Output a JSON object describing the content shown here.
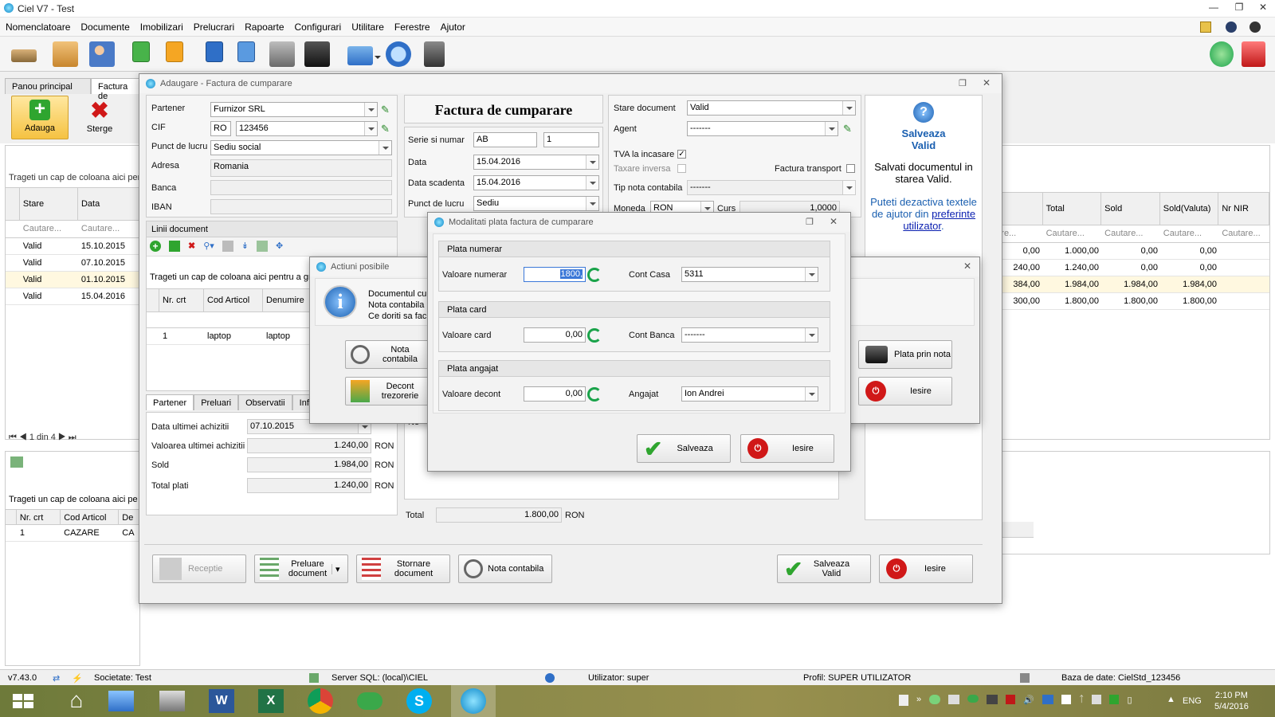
{
  "app": {
    "title": "Ciel V7 - Test"
  },
  "menu": [
    "Nomenclatoare",
    "Documente",
    "Imobilizari",
    "Prelucrari",
    "Rapoarte",
    "Configurari",
    "Utilitare",
    "Ferestre",
    "Ajutor"
  ],
  "tabs": {
    "main": "Panou principal",
    "second": "Factura de"
  },
  "ribbon": {
    "add": "Adauga",
    "delete": "Sterge"
  },
  "bg_grid": {
    "drag_hint": "Trageti un cap de coloana aici pen",
    "headers": [
      "Stare",
      "Data"
    ],
    "search": "Cautare...",
    "rows": [
      [
        "Valid",
        "15.10.2015"
      ],
      [
        "Valid",
        "07.10.2015"
      ],
      [
        "Valid",
        "01.10.2015"
      ],
      [
        "Valid",
        "15.04.2016"
      ]
    ],
    "right_headers": [
      "Total",
      "Sold",
      "Sold(Valuta)",
      "Nr NIR"
    ],
    "right_search": "Cautare...",
    "right_partial_search": "utare...",
    "right_rows": [
      [
        "0,00",
        "1.000,00",
        "0,00",
        "0,00"
      ],
      [
        "240,00",
        "1.240,00",
        "0,00",
        "0,00"
      ],
      [
        "384,00",
        "1.984,00",
        "1.984,00",
        "1.984,00"
      ],
      [
        "300,00",
        "1.800,00",
        "1.800,00",
        "1.800,00"
      ]
    ],
    "pager": "1 din 4"
  },
  "bg_lower": {
    "drag_hint": "Trageti un cap de coloana aici pe",
    "headers": [
      "Nr. crt",
      "Cod Articol",
      "De"
    ],
    "row": [
      "1",
      "CAZARE",
      "CA"
    ],
    "right_partial": "i"
  },
  "main_dialog": {
    "title": "Adaugare - Factura de cumparare",
    "heading": "Factura de cumparare",
    "partner": {
      "partener_label": "Partener",
      "partener": "Furnizor SRL",
      "cif_label": "CIF",
      "cif_prefix": "RO",
      "cif": "123456",
      "punct_label": "Punct de lucru",
      "punct": "Sediu social",
      "adresa_label": "Adresa",
      "adresa": "Romania",
      "banca_label": "Banca",
      "iban_label": "IBAN"
    },
    "serie": {
      "serie_label": "Serie si numar",
      "serie": "AB",
      "numar": "1",
      "data_label": "Data",
      "data": "15.04.2016",
      "scadenta_label": "Data scadenta",
      "scadenta": "15.04.2016",
      "punct_label": "Punct de lucru",
      "punct": "Sediu"
    },
    "stare": {
      "stare_label": "Stare document",
      "stare": "Valid",
      "agent_label": "Agent",
      "agent": "-------",
      "tva_label": "TVA la incasare",
      "taxare_label": "Taxare inversa",
      "transport_label": "Factura transport",
      "tip_label": "Tip nota contabila",
      "tip": "-------",
      "moneda_label": "Moneda",
      "moneda": "RON",
      "curs_label": "Curs",
      "curs": "1,0000"
    },
    "help": {
      "title_line1": "Salveaza",
      "title_line2": "Valid",
      "text": "Salvati documentul in starea Valid.",
      "hint_text": "Puteti dezactiva textele de ajutor din ",
      "hint_link": "preferinte utilizator",
      "hint_end": "."
    },
    "linii": {
      "title": "Linii document",
      "drag_hint": "Trageti un cap de coloana aici pentru a gr",
      "headers": [
        "Nr. crt",
        "Cod Articol",
        "Denumire"
      ],
      "row": [
        "1",
        "laptop",
        "laptop"
      ]
    },
    "lower_tabs": [
      "Partener",
      "Preluari",
      "Observatii",
      "Info"
    ],
    "partner_tab": {
      "last_date_label": "Data ultimei achizitii",
      "last_date": "07.10.2015",
      "last_value_label": "Valoarea ultimei achizitii",
      "last_value": "1.240,00",
      "sold_label": "Sold",
      "sold": "1.984,00",
      "total_label": "Total plati",
      "total": "1.240,00",
      "currency": "RON"
    },
    "partial_label": "Ne",
    "totals": {
      "label": "Total",
      "value": "1.800,00",
      "currency": "RON"
    },
    "bottom": {
      "receptie": "Receptie",
      "preluare": "Preluare document",
      "stornare": "Stornare document",
      "nota": "Nota contabila",
      "salveaza": "Salveaza Valid",
      "iesire": "Iesire"
    }
  },
  "actions_dialog": {
    "title": "Actiuni posibile",
    "msg1": "Documentul cu",
    "msg2": "Nota contabila",
    "msg3": "Ce doriti sa fac",
    "nota": "Nota contabila",
    "decont": "Decont trezorerie",
    "plata": "Plata prin nota",
    "iesire": "Iesire"
  },
  "payment_dialog": {
    "title": "Modalitati plata factura de cumparare",
    "numerar": {
      "group": "Plata numerar",
      "label": "Valoare numerar",
      "value": "1800,",
      "cont_label": "Cont Casa",
      "cont": "5311"
    },
    "card": {
      "group": "Plata card",
      "label": "Valoare card",
      "value": "0,00",
      "cont_label": "Cont Banca",
      "cont": "-------"
    },
    "angajat": {
      "group": "Plata angajat",
      "label": "Valoare decont",
      "value": "0,00",
      "cont_label": "Angajat",
      "cont": "Ion Andrei"
    },
    "salveaza": "Salveaza",
    "iesire": "Iesire"
  },
  "status": {
    "version": "v7.43.0",
    "societate": "Societate: Test",
    "server": "Server SQL: (local)\\CIEL",
    "utilizator": "Utilizator: super",
    "profil": "Profil: SUPER UTILIZATOR",
    "baza": "Baza de date: CielStd_123456"
  },
  "taskbar": {
    "lang": "ENG",
    "time": "2:10 PM",
    "date": "5/4/2016"
  }
}
